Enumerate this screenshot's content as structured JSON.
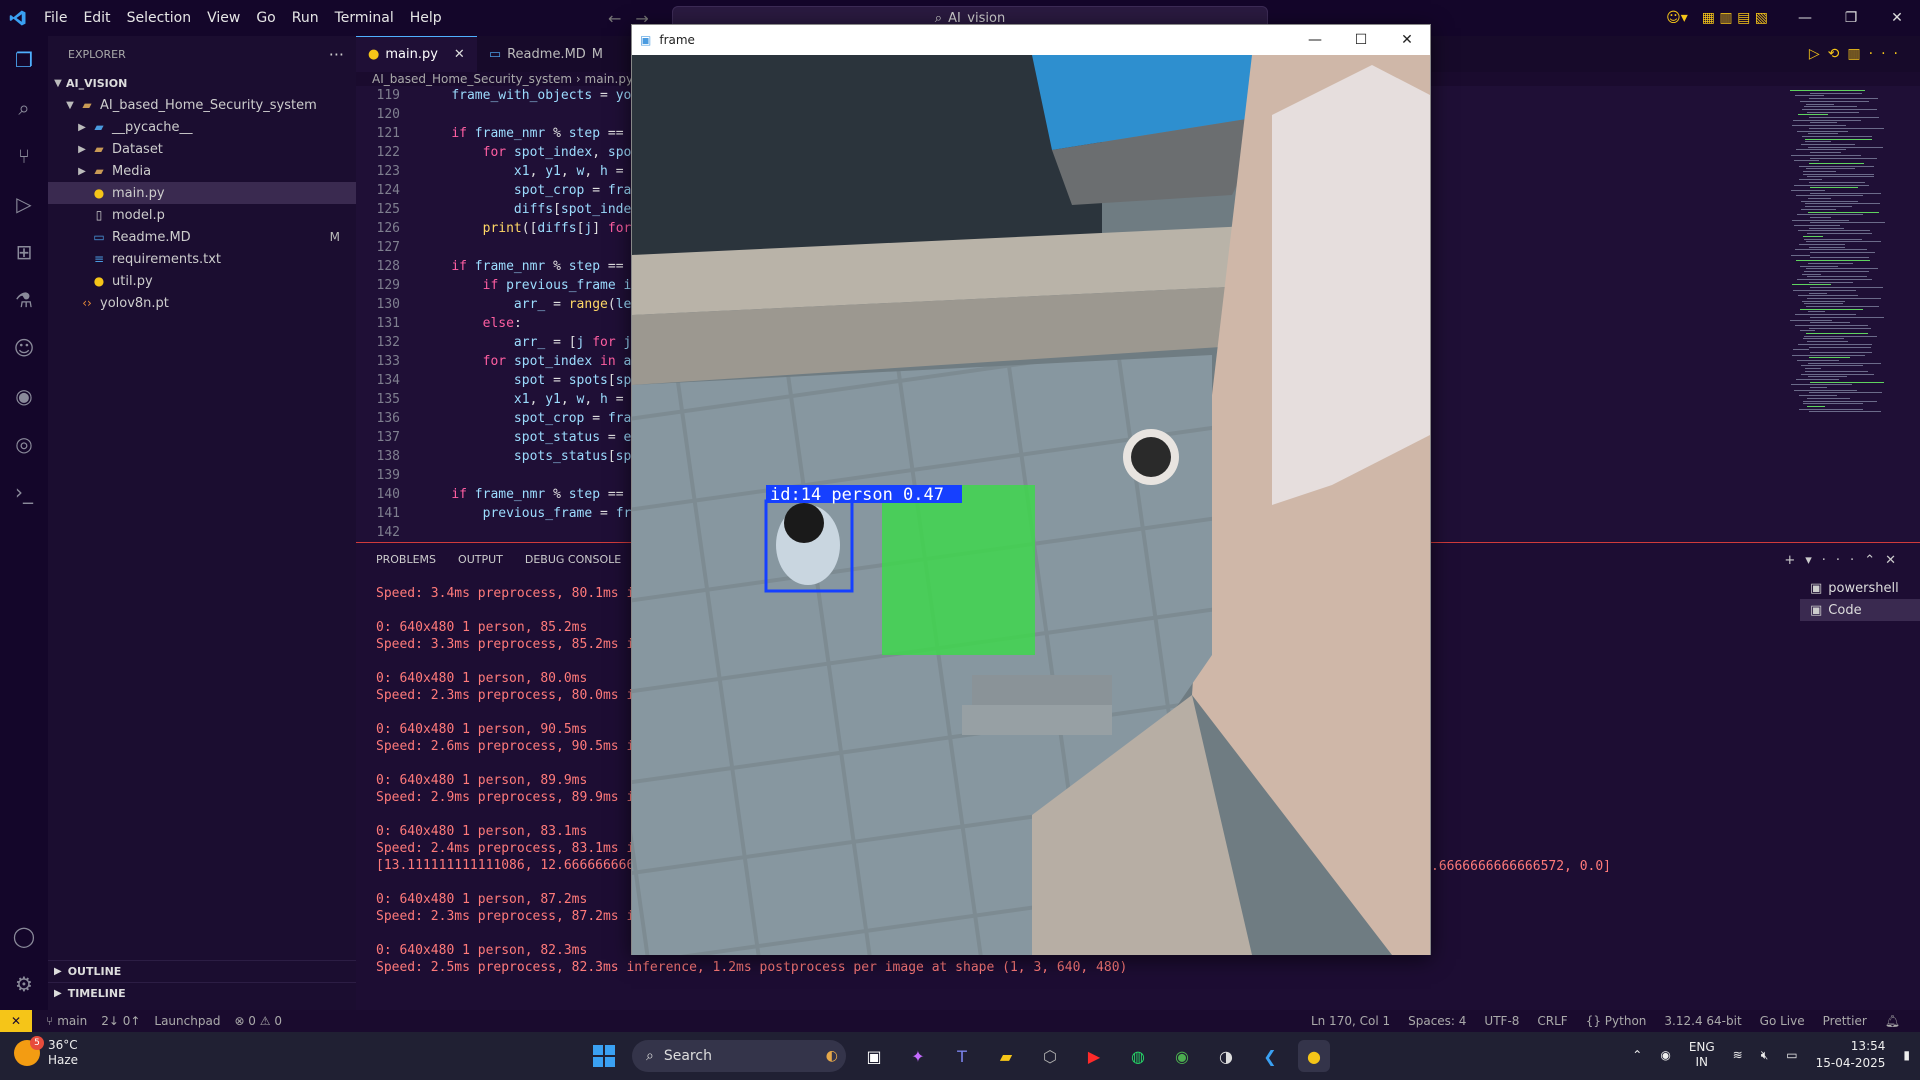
{
  "titlebar": {
    "menu": [
      "File",
      "Edit",
      "Selection",
      "View",
      "Go",
      "Run",
      "Terminal",
      "Help"
    ],
    "search": "AI_vision"
  },
  "sidebar": {
    "header": "EXPLORER",
    "root": "AI_VISION",
    "folder": "AI_based_Home_Security_system",
    "items": [
      {
        "label": "__pycache__",
        "type": "folder"
      },
      {
        "label": "Dataset",
        "type": "folder"
      },
      {
        "label": "Media",
        "type": "folder"
      },
      {
        "label": "main.py",
        "type": "py",
        "selected": true
      },
      {
        "label": "model.p",
        "type": "file"
      },
      {
        "label": "Readme.MD",
        "type": "md",
        "badge": "M"
      },
      {
        "label": "requirements.txt",
        "type": "txt"
      },
      {
        "label": "util.py",
        "type": "py"
      }
    ],
    "extra": "yolov8n.pt",
    "outline": "OUTLINE",
    "timeline": "TIMELINE"
  },
  "editor": {
    "tabs": [
      {
        "label": "main.py",
        "active": true
      },
      {
        "label": "Readme.MD",
        "badge": "M",
        "active": false
      }
    ],
    "breadcrumb": [
      "AI_based_Home_Security_system",
      "main.py"
    ],
    "lines": [
      {
        "n": "119",
        "t": "    frame_with_objects = yo"
      },
      {
        "n": "120",
        "t": ""
      },
      {
        "n": "121",
        "t": "    if frame_nmr % step =="
      },
      {
        "n": "122",
        "t": "        for spot_index, spo"
      },
      {
        "n": "123",
        "t": "            x1, y1, w, h ="
      },
      {
        "n": "124",
        "t": "            spot_crop = fra"
      },
      {
        "n": "125",
        "t": "            diffs[spot_inde"
      },
      {
        "n": "126",
        "t": "        print([diffs[j] for"
      },
      {
        "n": "127",
        "t": ""
      },
      {
        "n": "128",
        "t": "    if frame_nmr % step =="
      },
      {
        "n": "129",
        "t": "        if previous_frame i"
      },
      {
        "n": "130",
        "t": "            arr_ = range(le"
      },
      {
        "n": "131",
        "t": "        else:"
      },
      {
        "n": "132",
        "t": "            arr_ = [j for j"
      },
      {
        "n": "133",
        "t": "        for spot_index in a"
      },
      {
        "n": "134",
        "t": "            spot = spots[sp"
      },
      {
        "n": "135",
        "t": "            x1, y1, w, h ="
      },
      {
        "n": "136",
        "t": "            spot_crop = fra"
      },
      {
        "n": "137",
        "t": "            spot_status = e"
      },
      {
        "n": "138",
        "t": "            spots_status[sp"
      },
      {
        "n": "139",
        "t": ""
      },
      {
        "n": "140",
        "t": "    if frame_nmr % step =="
      },
      {
        "n": "141",
        "t": "        previous_frame = fr"
      },
      {
        "n": "142",
        "t": ""
      }
    ]
  },
  "panel": {
    "tabs": [
      "PROBLEMS",
      "OUTPUT",
      "DEBUG CONSOLE"
    ],
    "terminal": [
      "Speed: 3.4ms preprocess, 80.1ms infer",
      "",
      "0: 640x480 1 person, 85.2ms",
      "Speed: 3.3ms preprocess, 85.2ms infer",
      "",
      "0: 640x480 1 person, 80.0ms",
      "Speed: 2.3ms preprocess, 80.0ms infer",
      "",
      "0: 640x480 1 person, 90.5ms",
      "Speed: 2.6ms preprocess, 90.5ms infer",
      "",
      "0: 640x480 1 person, 89.9ms",
      "Speed: 2.9ms preprocess, 89.9ms infer",
      "",
      "0: 640x480 1 person, 83.1ms",
      "Speed: 2.4ms preprocess, 83.1ms infer",
      "[13.111111111111086, 12.666666666666",
      "",
      "0: 640x480 1 person, 87.2ms",
      "Speed: 2.3ms preprocess, 87.2ms infer",
      "",
      "0: 640x480 1 person, 82.3ms",
      "Speed: 2.5ms preprocess, 82.3ms inference, 1.2ms postprocess per image at shape (1, 3, 640, 480)"
    ],
    "ghost": ".6666666666666572, 0.0]",
    "terminals": [
      "powershell",
      "Code"
    ]
  },
  "statusbar": {
    "branch": "main",
    "sync": "2↓ 0↑",
    "launchpad": "Launchpad",
    "problems": "⊗ 0 ⚠ 0",
    "right": [
      "Ln 170, Col 1",
      "Spaces: 4",
      "UTF-8",
      "CRLF",
      "{} Python",
      "3.12.4 64-bit",
      "Go Live",
      "Prettier"
    ]
  },
  "frame": {
    "title": "frame",
    "label": "id:14 person 0.47"
  },
  "taskbar": {
    "weather_temp": "36°C",
    "weather_desc": "Haze",
    "weather_badge": "5",
    "search": "Search",
    "lang1": "ENG",
    "lang2": "IN",
    "time": "13:54",
    "date": "15-04-2025"
  }
}
